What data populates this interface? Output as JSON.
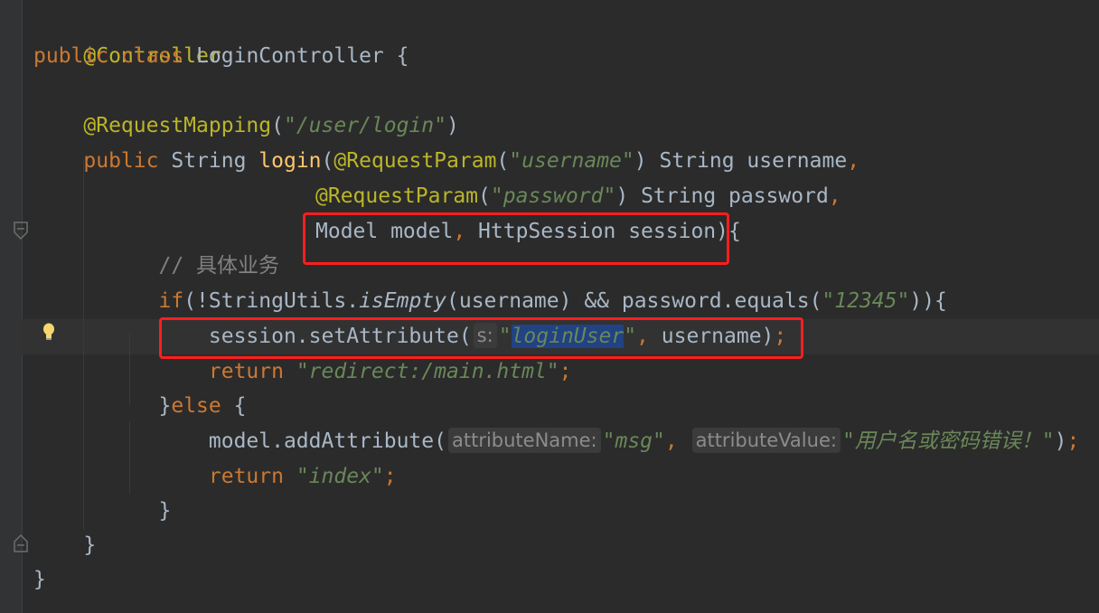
{
  "editor": {
    "theme": "darcula",
    "colors": {
      "background": "#2b2b2b",
      "keyword": "#cc7832",
      "annotation": "#bbb529",
      "string": "#6a8759",
      "comment": "#808080",
      "method": "#ffc66d",
      "default": "#a9b7c6",
      "highlight_box": "#ff1e1e",
      "selection": "#214283"
    },
    "icons": [
      "fold-icon",
      "lightbulb-icon"
    ],
    "lines": {
      "l1": {
        "ann": "@Controller"
      },
      "l2": {
        "kw1": "public",
        "kw2": "class",
        "name": "LoginController",
        "brace": "{"
      },
      "l4": {
        "ann": "@RequestMapping",
        "p1": "(",
        "str": "\"/user/login\"",
        "p2": ")"
      },
      "l5": {
        "kw": "public",
        "type": "String",
        "method": "login",
        "p1": "(",
        "ann": "@RequestParam",
        "p2": "(",
        "str": "\"username\"",
        "p3": ")",
        "rest": "String username",
        "comma": ","
      },
      "l6": {
        "ann": "@RequestParam",
        "p1": "(",
        "str": "\"password\"",
        "p2": ")",
        "rest": "String password",
        "comma": ","
      },
      "l7": {
        "a": "Model model",
        "comma": ",",
        "b": "HttpSession session){"
      },
      "l8": {
        "comment": "// 具体业务"
      },
      "l9": {
        "kw": "if",
        "a": "(!StringUtils.",
        "stat": "isEmpty",
        "b": "(username) && password.equals(",
        "str": "\"12345\"",
        "c": ")){"
      },
      "l10": {
        "a": "session.setAttribute(",
        "hint": "s:",
        "q1": "\"",
        "sel": "loginUser",
        "q2": "\"",
        "comma": ",",
        "b": "username)",
        "semi": ";"
      },
      "l11": {
        "kw": "return",
        "str": "\"redirect:/main.html\"",
        "semi": ";"
      },
      "l12": {
        "a": "}",
        "kw": "else",
        "b": "{"
      },
      "l13": {
        "a": "model.addAttribute(",
        "hint1": "attributeName:",
        "str1": "\"msg\"",
        "comma": ",",
        "hint2": "attributeValue:",
        "str2": "\"用户名或密码错误！\"",
        "b": ")",
        "semi": ";"
      },
      "l14": {
        "kw": "return",
        "str": "\"index\"",
        "semi": ";"
      },
      "l15": {
        "a": "}"
      },
      "l16": {
        "a": "}"
      },
      "l17": {
        "a": "}"
      }
    }
  }
}
